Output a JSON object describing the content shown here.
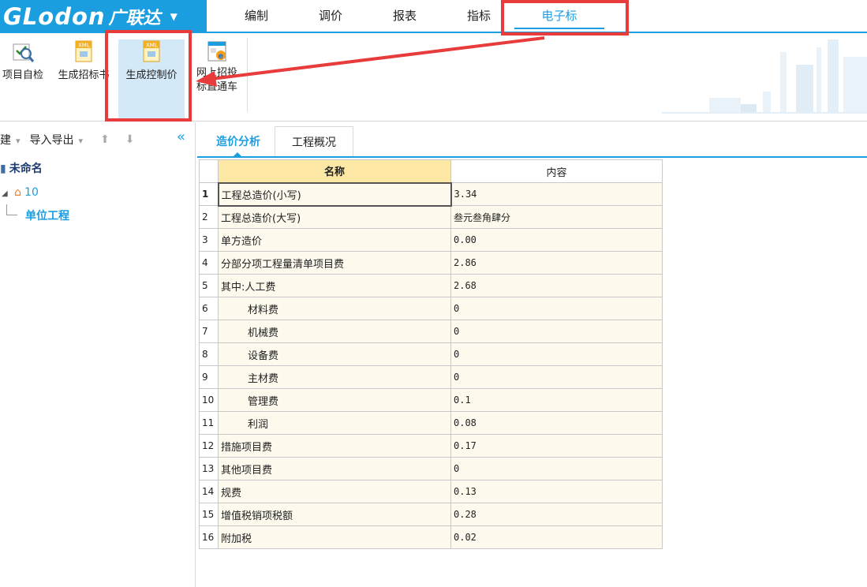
{
  "brand": {
    "logo": "GLodon",
    "cn": "广联达",
    "caret": "▼"
  },
  "menu": {
    "items": [
      {
        "label": "编制"
      },
      {
        "label": "调价"
      },
      {
        "label": "报表"
      },
      {
        "label": "指标"
      },
      {
        "label": "电子标"
      }
    ]
  },
  "ribbon": {
    "buttons": [
      {
        "label": "项目自检"
      },
      {
        "label": "生成招标书"
      },
      {
        "label": "生成控制价"
      },
      {
        "label_line1": "网上招投",
        "label_line2": "标直通车"
      }
    ]
  },
  "left_panel": {
    "toolbar": {
      "new": "建",
      "import_export": "导入导出",
      "caret": "▾"
    },
    "tree": {
      "project": "未命名",
      "node": "10",
      "unit": "单位工程"
    }
  },
  "tabs": [
    {
      "label": "造价分析"
    },
    {
      "label": "工程概况"
    }
  ],
  "table": {
    "headers": {
      "name": "名称",
      "content": "内容"
    },
    "rows": [
      {
        "idx": "1",
        "name": "工程总造价(小写)",
        "value": "3.34"
      },
      {
        "idx": "2",
        "name": "工程总造价(大写)",
        "value": "叁元叁角肆分"
      },
      {
        "idx": "3",
        "name": "单方造价",
        "value": "0.00"
      },
      {
        "idx": "4",
        "name": "分部分项工程量清单项目费",
        "value": "2.86"
      },
      {
        "idx": "5",
        "name": "其中:人工费",
        "value": "2.68"
      },
      {
        "idx": "6",
        "name": "材料费",
        "value": "0"
      },
      {
        "idx": "7",
        "name": "机械费",
        "value": "0"
      },
      {
        "idx": "8",
        "name": "设备费",
        "value": "0"
      },
      {
        "idx": "9",
        "name": "主材费",
        "value": "0"
      },
      {
        "idx": "10",
        "name": "管理费",
        "value": "0.1"
      },
      {
        "idx": "11",
        "name": "利润",
        "value": "0.08"
      },
      {
        "idx": "12",
        "name": "措施项目费",
        "value": "0.17"
      },
      {
        "idx": "13",
        "name": "其他项目费",
        "value": "0"
      },
      {
        "idx": "14",
        "name": "规费",
        "value": "0.13"
      },
      {
        "idx": "15",
        "name": "增值税销项税额",
        "value": "0.28"
      },
      {
        "idx": "16",
        "name": "附加税",
        "value": "0.02"
      }
    ]
  },
  "colors": {
    "accent": "#1a9ee0",
    "annotation": "#e83b3b",
    "header_highlight": "#fde7a4"
  }
}
